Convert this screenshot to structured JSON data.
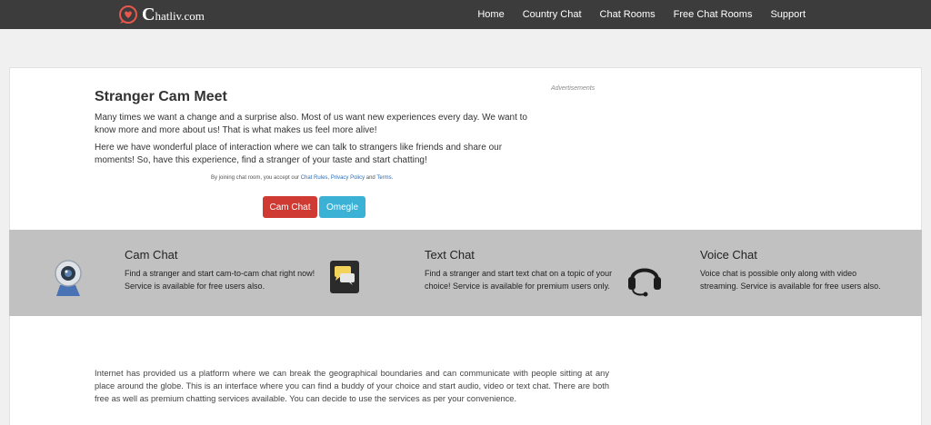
{
  "header": {
    "logo_initial": "C",
    "logo_rest": "hatliv.com",
    "nav": [
      "Home",
      "Country Chat",
      "Chat Rooms",
      "Free Chat Rooms",
      "Support"
    ]
  },
  "intro": {
    "title": "Stranger Cam Meet",
    "p1": "Many times we want a change and a surprise also. Most of us want new experiences every day. We want to know more and more about us! That is what makes us feel more alive!",
    "p2": "Here we have wonderful place of interaction where we can talk to strangers like friends and share our moments! So, have this experience, find a stranger of your taste and start chatting!",
    "ads_label": "Advertisements",
    "terms_prefix": "By joining chat room, you accept our ",
    "chat_rules": "Chat Rules",
    "sep1": ", ",
    "privacy_policy": "Privacy Policy",
    "and": " and ",
    "terms": "Terms",
    "period": ".",
    "btn_cam": "Cam Chat",
    "btn_omegle": "Omegle"
  },
  "features": [
    {
      "title": "Cam Chat",
      "desc": "Find a stranger and start cam-to-cam chat right now! Service is available for free users also.",
      "icon": "webcam-icon"
    },
    {
      "title": "Text Chat",
      "desc": "Find a stranger and start text chat on a topic of your choice! Service is available for premium users only.",
      "icon": "chat-bubbles-icon"
    },
    {
      "title": "Voice Chat",
      "desc": "Voice chat is possible only along with video streaming. Service is available for free users also.",
      "icon": "headset-icon"
    }
  ],
  "bottom_text": "Internet has provided us a platform where we can break the geographical boundaries and can communicate with people sitting at any place around the globe. This is an interface where you can find a buddy of your choice and start audio, video or text chat. There are both free as well as premium chatting services available. You can decide to use the services as per your convenience.",
  "colors": {
    "navbar": "#3c3c3c",
    "cam_button": "#cf3b33",
    "omegle_button": "#3bb1d6",
    "features_band": "#c1c1c1",
    "logo_accent": "#e8574a"
  }
}
